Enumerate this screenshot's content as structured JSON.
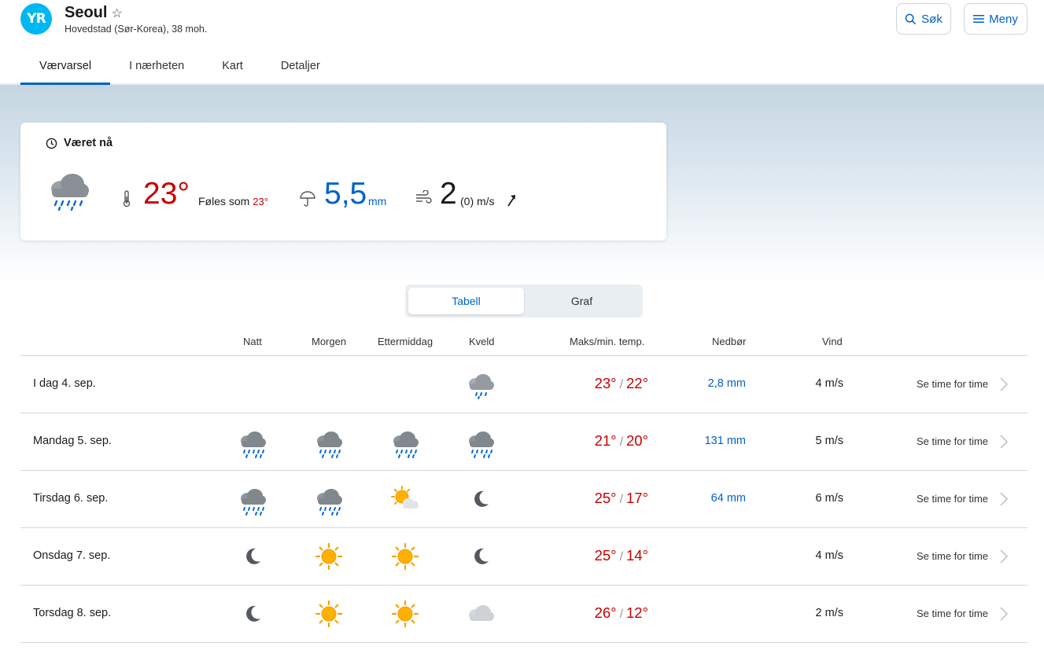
{
  "header": {
    "logo_text": "YR",
    "city": "Seoul",
    "subtitle": "Hovedstad (Sør-Korea), 38 moh.",
    "search_label": "Søk",
    "menu_label": "Meny"
  },
  "tabs": [
    {
      "label": "Værvarsel",
      "active": true
    },
    {
      "label": "I nærheten",
      "active": false
    },
    {
      "label": "Kart",
      "active": false
    },
    {
      "label": "Detaljer",
      "active": false
    }
  ],
  "now": {
    "title": "Været nå",
    "icon": "heavy-rain-cloud-icon",
    "temperature": "23°",
    "feels_like_label": "Føles som",
    "feels_like_value": "23°",
    "precipitation": "5,5",
    "precipitation_unit": "mm",
    "wind": "2",
    "wind_gust": "(0) m/s",
    "wind_direction_icon": "wind-arrow-icon"
  },
  "view_toggle": {
    "table_label": "Tabell",
    "graph_label": "Graf",
    "selected": "Tabell"
  },
  "table": {
    "headers": {
      "night": "Natt",
      "morning": "Morgen",
      "afternoon": "Ettermiddag",
      "evening": "Kveld",
      "maxmin": "Maks/min. temp.",
      "precip": "Nedbør",
      "wind": "Vind"
    },
    "more_label": "Se time for time",
    "rows": [
      {
        "day": "I dag 4. sep.",
        "icons": [
          "",
          "",
          "",
          "rain"
        ],
        "max": "23°",
        "min": "22°",
        "precip": "2,8 mm",
        "wind": "4 m/s"
      },
      {
        "day": "Mandag 5. sep.",
        "icons": [
          "heavyrain",
          "heavyrain",
          "heavyrain",
          "heavyrain"
        ],
        "max": "21°",
        "min": "20°",
        "precip": "131 mm",
        "wind": "5 m/s"
      },
      {
        "day": "Tirsdag 6. sep.",
        "icons": [
          "heavyrain",
          "heavyrain",
          "partlycloudy",
          "moon"
        ],
        "max": "25°",
        "min": "17°",
        "precip": "64 mm",
        "wind": "6 m/s"
      },
      {
        "day": "Onsdag 7. sep.",
        "icons": [
          "moon",
          "sun",
          "sun",
          "moon"
        ],
        "max": "25°",
        "min": "14°",
        "precip": "",
        "wind": "4 m/s"
      },
      {
        "day": "Torsdag 8. sep.",
        "icons": [
          "moon",
          "sun",
          "sun",
          "cloud"
        ],
        "max": "26°",
        "min": "12°",
        "precip": "",
        "wind": "2 m/s"
      }
    ]
  },
  "colors": {
    "accent": "#0062c9",
    "warm": "#c60000",
    "logo": "#00b8f1"
  }
}
